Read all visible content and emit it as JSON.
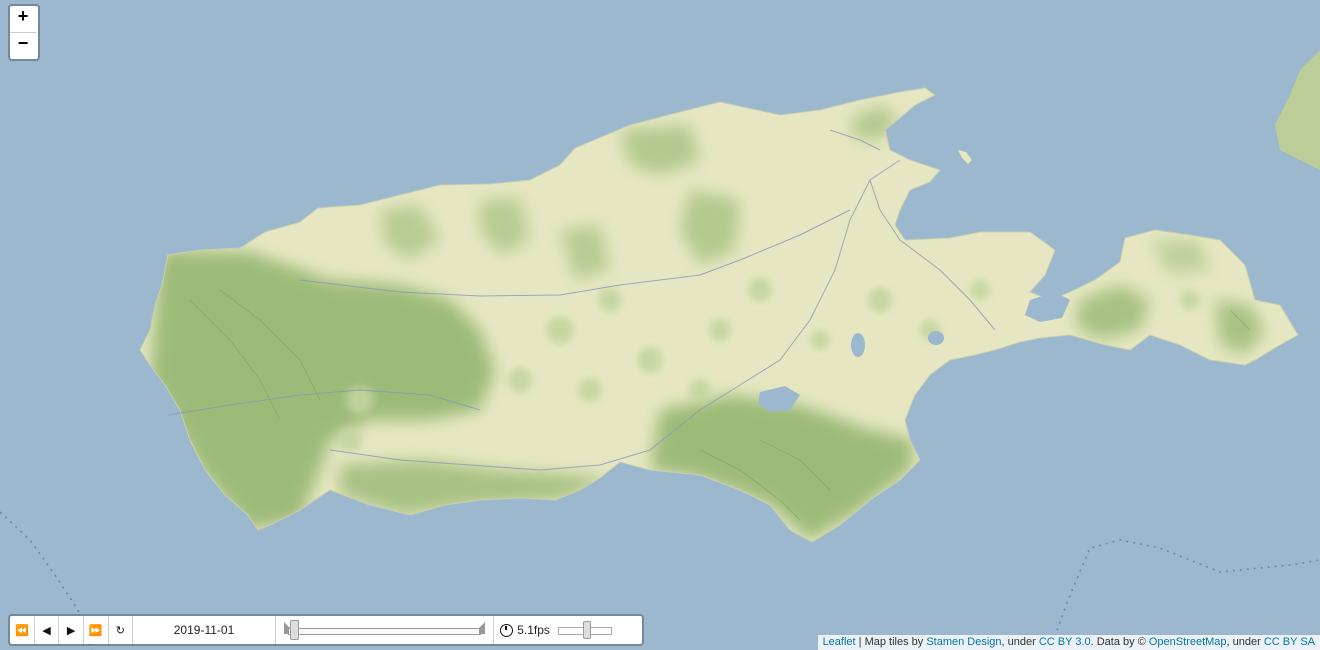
{
  "map": {
    "zoom_in": "+",
    "zoom_out": "−",
    "colors": {
      "water": "#9bb8cf",
      "lowland": "#e6e7c2",
      "forest": "#9dbb78",
      "ridge": "#7e9e5d",
      "road": "#8a96b8",
      "boundary": "#6d8a9e"
    }
  },
  "time_control": {
    "backward_icon": "⏪",
    "prev_icon": "◀",
    "play_icon": "▶",
    "forward_icon": "⏩",
    "loop_icon": "↻",
    "date": "2019-11-01",
    "time_progress": 0.0,
    "speed": "5.1fps",
    "speed_level": 0.5
  },
  "attribution": {
    "leaflet": "Leaflet",
    "sep": " | Map tiles by ",
    "stamen": "Stamen Design",
    "under1": ", under ",
    "ccby": "CC BY 3.0",
    "data_by": ". Data by © ",
    "osm": "OpenStreetMap",
    "under2": ", under ",
    "cc2": "CC BY SA"
  }
}
